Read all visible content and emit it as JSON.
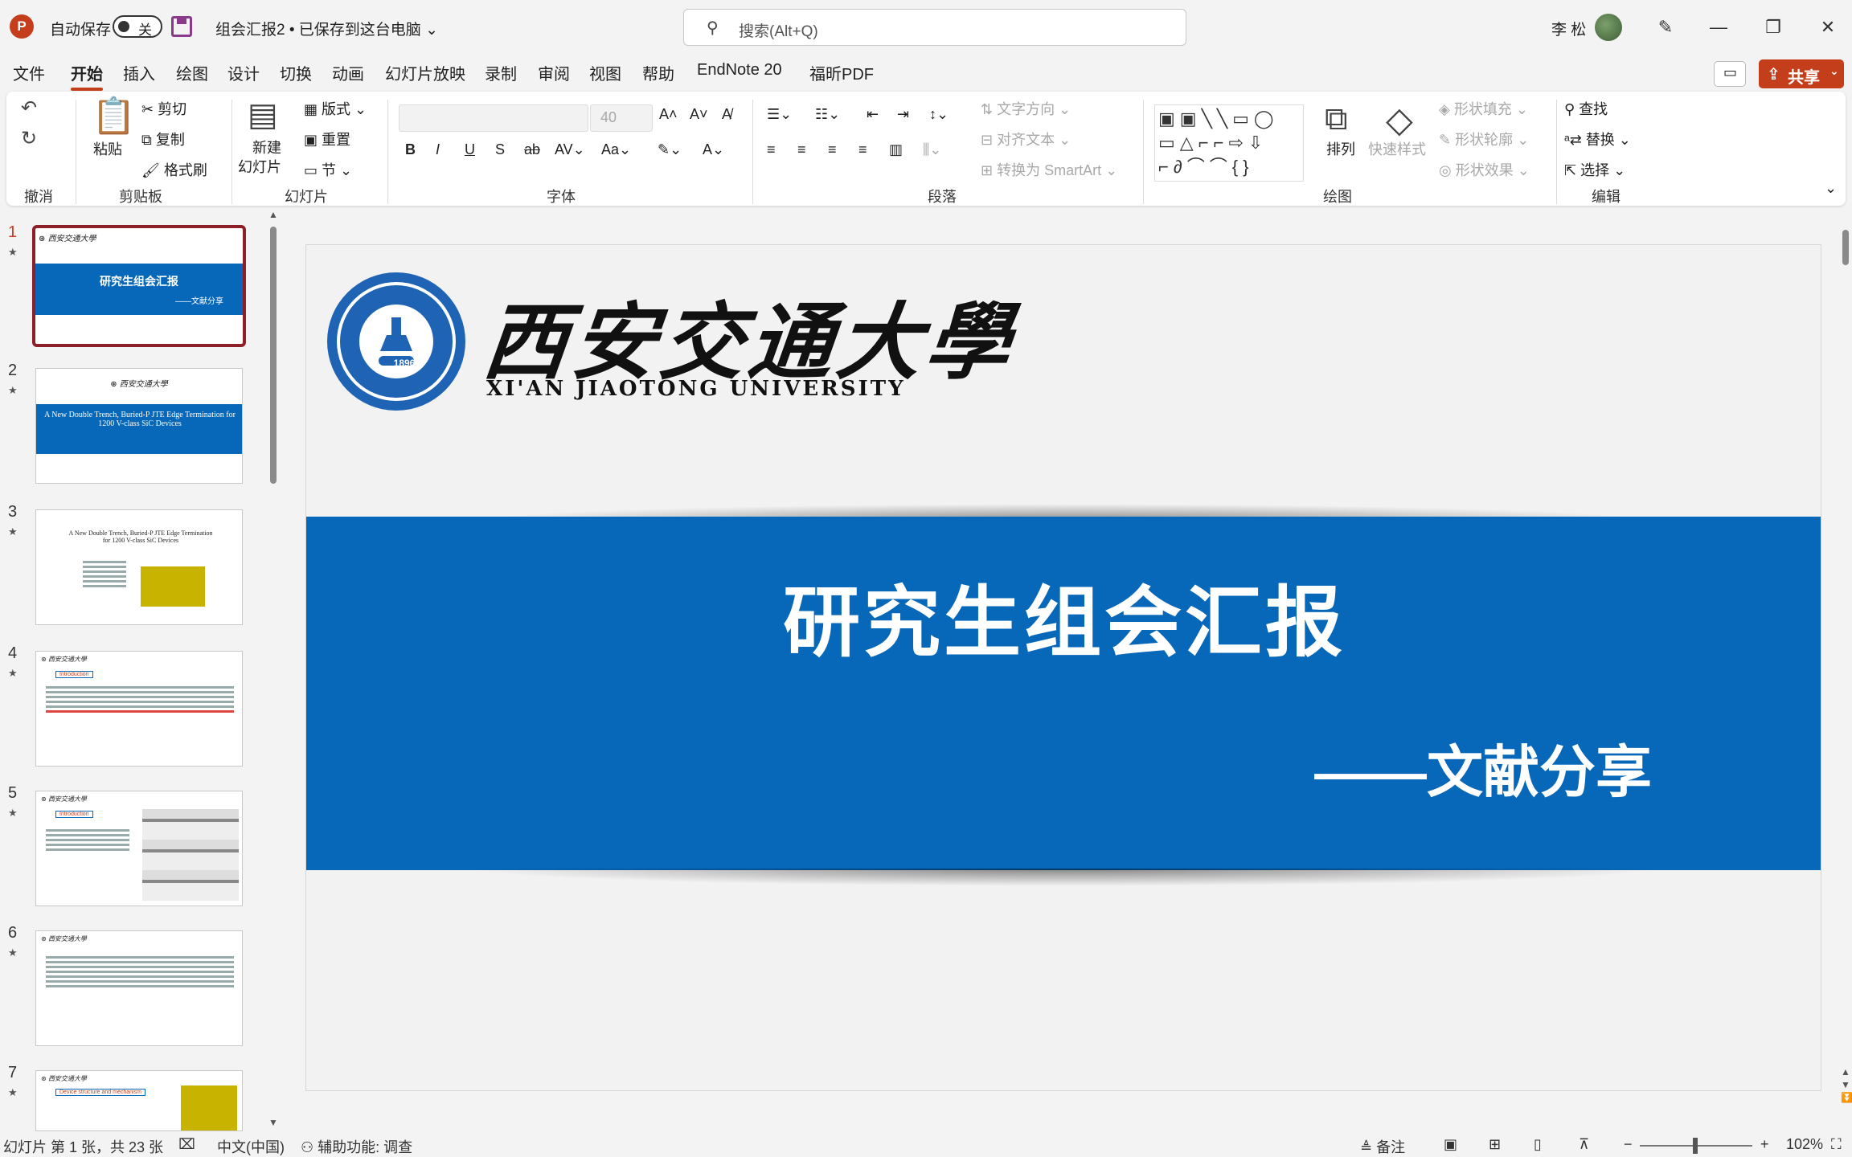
{
  "app": {
    "logo_letter": "P",
    "autosave_label": "自动保存",
    "autosave_state": "关",
    "doc_title": "组会汇报2 • 已保存到这台电脑",
    "search_placeholder": "搜索(Alt+Q)",
    "user_name": "李 松"
  },
  "menu": {
    "tabs": [
      "文件",
      "开始",
      "插入",
      "绘图",
      "设计",
      "切换",
      "动画",
      "幻灯片放映",
      "录制",
      "审阅",
      "视图",
      "帮助",
      "EndNote 20",
      "福昕PDF"
    ],
    "active": "开始",
    "share_label": "共享"
  },
  "ribbon": {
    "undo_group": "撤消",
    "clipboard": {
      "paste": "粘贴",
      "cut": "剪切",
      "copy": "复制",
      "format_painter": "格式刷",
      "group": "剪贴板"
    },
    "slides": {
      "new_slide": "新建",
      "new_slide2": "幻灯片",
      "layout": "版式",
      "reset": "重置",
      "section": "节",
      "group": "幻灯片"
    },
    "font": {
      "size": "40",
      "group": "字体"
    },
    "paragraph": {
      "text_direction": "文字方向",
      "align_text": "对齐文本",
      "smartart": "转换为 SmartArt",
      "group": "段落"
    },
    "drawing": {
      "arrange": "排列",
      "quick_styles": "快速样式",
      "shape_fill": "形状填充",
      "shape_outline": "形状轮廓",
      "shape_effects": "形状效果",
      "group": "绘图"
    },
    "editing": {
      "find": "查找",
      "replace": "替换",
      "select": "选择",
      "group": "编辑"
    }
  },
  "thumbnails": [
    {
      "num": "1",
      "title": "研究生组会汇报",
      "sub": "——文献分享"
    },
    {
      "num": "2",
      "title": "A New Double Trench, Buried-P JTE Edge Termination for 1200 V-class SiC Devices"
    },
    {
      "num": "3",
      "title": "A New Double Trench, Buried-P JTE Edge Termination for 1200 V-class SiC Devices"
    },
    {
      "num": "4",
      "title": "Introduction"
    },
    {
      "num": "5",
      "title": "Introduction"
    },
    {
      "num": "6",
      "title": ""
    },
    {
      "num": "7",
      "title": "Device structure and mechanism"
    }
  ],
  "slide": {
    "university_cn": "西安交通大學",
    "university_en": "XI'AN JIAOTONG UNIVERSITY",
    "seal_year": "1896",
    "title": "研究生组会汇报",
    "subtitle": "——文献分享"
  },
  "status": {
    "slide_info": "幻灯片 第 1 张，共 23 张",
    "language": "中文(中国)",
    "accessibility": "辅助功能: 调查",
    "notes": "备注",
    "zoom": "102%"
  },
  "colors": {
    "accent": "#c43e1c",
    "band": "#0767b8",
    "selected_thumb": "#8c1f28"
  }
}
